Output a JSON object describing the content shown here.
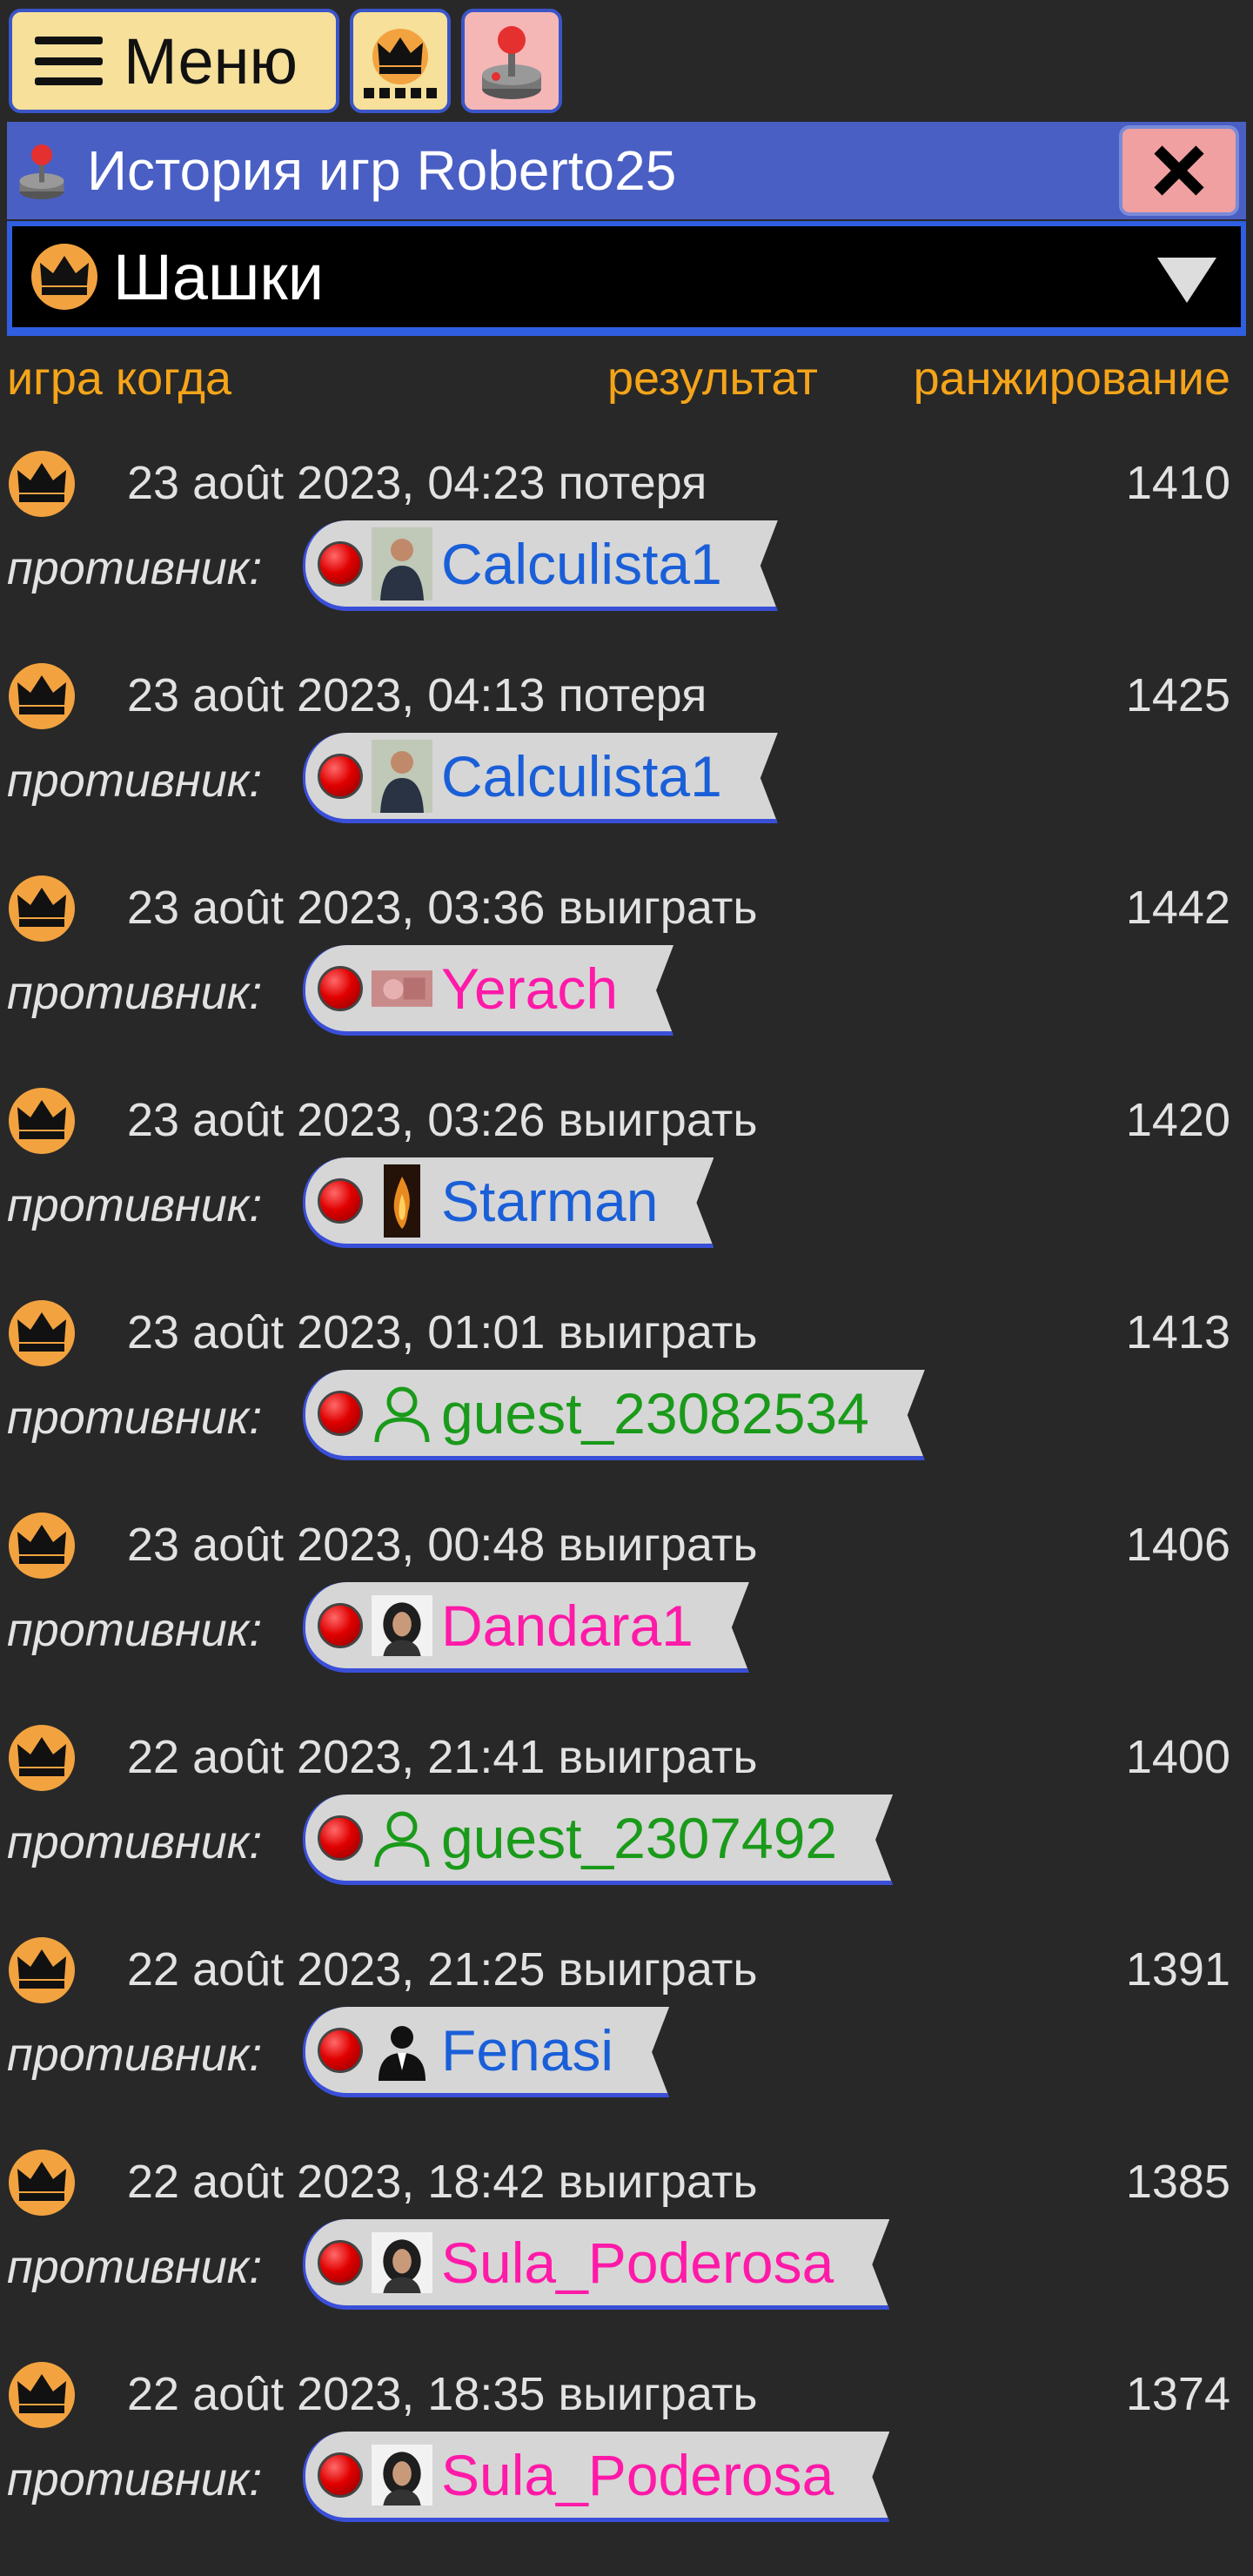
{
  "toolbar": {
    "menu_label": "Меню"
  },
  "titlebar": {
    "title": "История игр Roberto25"
  },
  "game_select": {
    "selected": "Шашки"
  },
  "table_header": {
    "game_when": "игра когда",
    "result": "результат",
    "rating": "ранжирование"
  },
  "opponent_label": "противник:",
  "colors": {
    "accent_blue": "#4a5fc4",
    "header_orange": "#f5a41a",
    "link_blue": "#1a5fd8",
    "pink": "#ff1aa8",
    "green": "#1a9a1a"
  },
  "games": [
    {
      "when": "23 août 2023, 04:23 потеря",
      "rating": "1410",
      "opponent": "Calculista1",
      "name_color": "#1a5fd8",
      "avatar": "photo-man-icon"
    },
    {
      "when": "23 août 2023, 04:13 потеря",
      "rating": "1425",
      "opponent": "Calculista1",
      "name_color": "#1a5fd8",
      "avatar": "photo-man-icon"
    },
    {
      "when": "23 août 2023, 03:36 выиграть",
      "rating": "1442",
      "opponent": "Yerach",
      "name_color": "#ff1aa8",
      "avatar": "photo-pink-icon"
    },
    {
      "when": "23 août 2023, 03:26 выиграть",
      "rating": "1420",
      "opponent": "Starman",
      "name_color": "#1a5fd8",
      "avatar": "photo-flame-icon"
    },
    {
      "when": "23 août 2023, 01:01 выиграть",
      "rating": "1413",
      "opponent": "guest_23082534",
      "name_color": "#1a9a1a",
      "avatar": "guest-user-icon"
    },
    {
      "when": "23 août 2023, 00:48 выиграть",
      "rating": "1406",
      "opponent": "Dandara1",
      "name_color": "#ff1aa8",
      "avatar": "photo-woman-icon"
    },
    {
      "when": "22 août 2023, 21:41 выиграть",
      "rating": "1400",
      "opponent": "guest_2307492",
      "name_color": "#1a9a1a",
      "avatar": "guest-user-icon"
    },
    {
      "when": "22 août 2023, 21:25 выиграть",
      "rating": "1391",
      "opponent": "Fenasi",
      "name_color": "#1a5fd8",
      "avatar": "businessman-icon"
    },
    {
      "when": "22 août 2023, 18:42 выиграть",
      "rating": "1385",
      "opponent": "Sula_Poderosa",
      "name_color": "#ff1aa8",
      "avatar": "photo-woman-icon"
    },
    {
      "when": "22 août 2023, 18:35 выиграть",
      "rating": "1374",
      "opponent": "Sula_Poderosa",
      "name_color": "#ff1aa8",
      "avatar": "photo-woman-icon"
    }
  ]
}
